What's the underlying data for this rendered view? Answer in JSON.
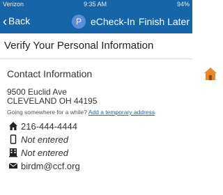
{
  "status_bar": {
    "carrier": "Verizon",
    "time": "9:35 AM",
    "battery": "94%"
  },
  "nav": {
    "back_label": "Back",
    "badge": "P",
    "title": "eCheck-In",
    "finish_label": "Finish Later"
  },
  "page": {
    "title": "Verify Your Personal Information"
  },
  "contact": {
    "section_title": "Contact Information",
    "address_line1": "9500 Euclid Ave",
    "address_line2": "CLEVELAND OH 44195",
    "temp_prompt": "Going somewhere for a while?",
    "temp_link": "Add a temporary address",
    "home_phone": "216-444-4444",
    "mobile_phone": "Not entered",
    "work_phone": "Not entered",
    "email": "birdm@ccf.org"
  },
  "colors": {
    "nav_bg": "#1565a8",
    "link": "#1565c0",
    "home_icon": "#e58a2a"
  }
}
